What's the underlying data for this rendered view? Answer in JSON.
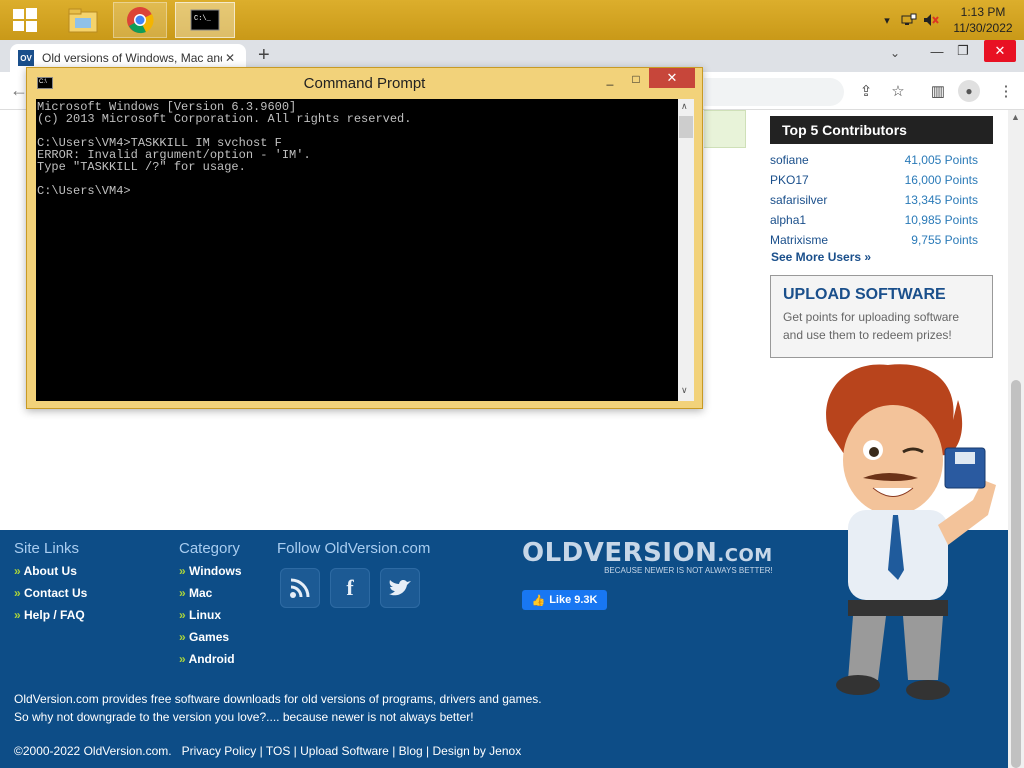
{
  "taskbar": {
    "time": "1:13 PM",
    "date": "11/30/2022",
    "apps": [
      "start-icon",
      "file-explorer-icon",
      "chrome-icon",
      "command-prompt-icon"
    ]
  },
  "browser": {
    "tab_title": "Old versions of Windows, Mac and",
    "favicon": "OV",
    "tab_close": "✕",
    "new_tab": "+"
  },
  "sidebar": {
    "contributors_title": "Top 5 Contributors",
    "contributors": [
      {
        "name": "sofiane",
        "points": "41,005 Points"
      },
      {
        "name": "PKO17",
        "points": "16,000 Points"
      },
      {
        "name": "safarisilver",
        "points": "13,345 Points"
      },
      {
        "name": "alpha1",
        "points": "10,985 Points"
      },
      {
        "name": "Matrixisme",
        "points": "9,755 Points"
      }
    ],
    "see_more": "See More Users »",
    "upload_title": "UPLOAD SOFTWARE",
    "upload_text": "Get points for uploading software and use them to redeem prizes!"
  },
  "footer": {
    "site_links_title": "Site Links",
    "site_links": [
      "About Us",
      "Contact Us",
      "Help / FAQ"
    ],
    "category_title": "Category",
    "categories": [
      "Windows",
      "Mac",
      "Linux",
      "Games",
      "Android"
    ],
    "follow_title": "Follow OldVersion.com",
    "logo_main": "OLDVERSION",
    "logo_com": ".COM",
    "logo_tag": "BECAUSE NEWER IS NOT ALWAYS BETTER!",
    "fb_like": "Like 9.3K",
    "desc_line1": "OldVersion.com provides free software downloads for old versions of programs, drivers and games.",
    "desc_line2": "So why not downgrade to the version you love?.... because newer is not always better!",
    "copyright": "©2000-2022 OldVersion.com.",
    "copy_links": [
      "Privacy Policy",
      "TOS",
      "Upload Software",
      "Blog",
      "Design by Jenox"
    ]
  },
  "cmd": {
    "title": "Command Prompt",
    "min": "_",
    "max": "□",
    "close": "✕",
    "lines": [
      "Microsoft Windows [Version 6.3.9600]",
      "(c) 2013 Microsoft Corporation. All rights reserved.",
      "",
      "C:\\Users\\VM4>TASKKILL IM svchost F",
      "ERROR: Invalid argument/option - 'IM'.",
      "Type \"TASKKILL /?\" for usage.",
      "",
      "C:\\Users\\VM4>"
    ]
  },
  "colors": {
    "taskbar": "#d6a423",
    "footer": "#0d4d87",
    "accent_green": "#a8d23c",
    "cmd_close": "#c7463a"
  }
}
